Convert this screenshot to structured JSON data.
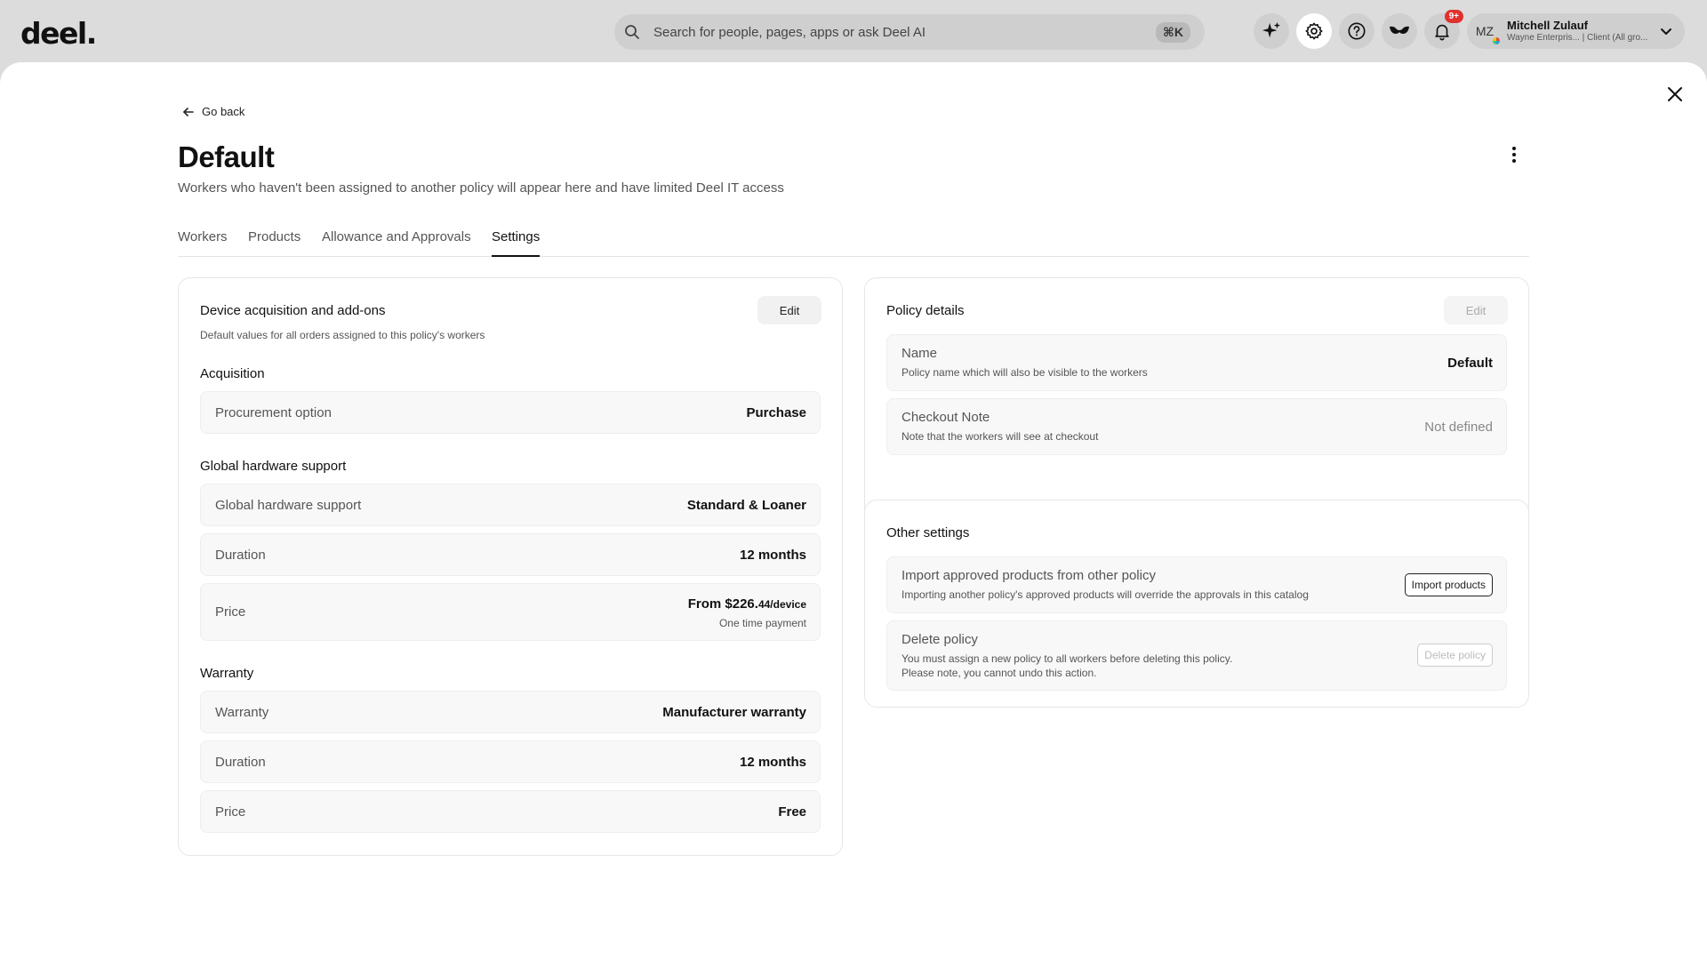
{
  "app": {
    "logo": "deel."
  },
  "search": {
    "placeholder": "Search for people, pages, apps or ask Deel AI",
    "shortcut": "⌘K"
  },
  "topbar": {
    "notifications_badge": "9+"
  },
  "user": {
    "initials": "MZ",
    "name": "Mitchell Zulauf",
    "subtitle": "Wayne Enterpris... | Client (All gro..."
  },
  "page": {
    "back_label": "Go back",
    "title": "Default",
    "subtitle": "Workers who haven't been assigned to another policy will appear here and have limited Deel IT access"
  },
  "tabs": [
    {
      "label": "Workers"
    },
    {
      "label": "Products"
    },
    {
      "label": "Allowance and Approvals"
    },
    {
      "label": "Settings"
    }
  ],
  "device_card": {
    "title": "Device acquisition and add-ons",
    "description": "Default values for all orders assigned to this policy's workers",
    "edit_label": "Edit",
    "acquisition": {
      "title": "Acquisition",
      "rows": [
        {
          "label": "Procurement option",
          "value": "Purchase"
        }
      ]
    },
    "hardware": {
      "title": "Global hardware support",
      "support_label": "Global hardware support",
      "support_value": "Standard & Loaner",
      "duration_label": "Duration",
      "duration_value": "12 months",
      "price_label": "Price",
      "price_prefix": "From $226.",
      "price_cents": "44/device",
      "price_note": "One time payment"
    },
    "warranty": {
      "title": "Warranty",
      "warranty_label": "Warranty",
      "warranty_value": "Manufacturer warranty",
      "duration_label": "Duration",
      "duration_value": "12 months",
      "price_label": "Price",
      "price_value": "Free"
    }
  },
  "policy_card": {
    "title": "Policy details",
    "edit_label": "Edit",
    "name_label": "Name",
    "name_desc": "Policy name which will also be visible to the workers",
    "name_value": "Default",
    "note_label": "Checkout Note",
    "note_desc": "Note that the workers will see at checkout",
    "note_value": "Not defined"
  },
  "other_card": {
    "title": "Other settings",
    "import_label": "Import approved products from other policy",
    "import_desc": "Importing another policy's approved products will override the approvals in this catalog",
    "import_button": "Import products",
    "delete_label": "Delete policy",
    "delete_desc_1": "You must assign a new policy to all workers before deleting this policy.",
    "delete_desc_2": "Please note, you cannot undo this action.",
    "delete_button": "Delete policy"
  }
}
